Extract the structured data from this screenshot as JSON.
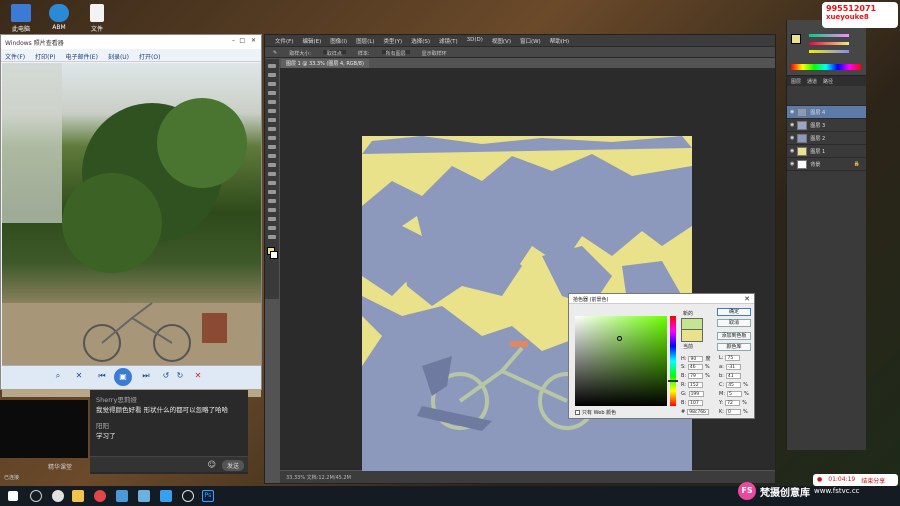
{
  "desktop": {
    "icons": [
      {
        "label": "此电脑",
        "icon": "computer-icon",
        "color": "#3b7bd6"
      },
      {
        "label": "ABM",
        "icon": "app-icon",
        "color": "#2a8ad6"
      },
      {
        "label": "文件",
        "icon": "file-icon",
        "color": "#f3f3f3"
      }
    ]
  },
  "viewer": {
    "title": "Windows 照片查看器",
    "menu": [
      "文件(F)",
      "打印(P)",
      "电子邮件(E)",
      "刻录(U)",
      "打开(O)"
    ],
    "controls": [
      "zoom-icon",
      "fit-icon",
      "prev-icon",
      "slideshow-icon",
      "next-icon",
      "rotate-left-icon",
      "rotate-right-icon",
      "delete-icon"
    ]
  },
  "chat": {
    "messages": [
      {
        "user": "Sherry思莉娅",
        "text": "我觉得颜色好看 形状什么的都可以忽略了哈哈"
      },
      {
        "user": "阳阳",
        "text": "学习了"
      }
    ],
    "send_label": "发送",
    "panel_label": "精华课堂",
    "status": "已连接"
  },
  "ps": {
    "menu": [
      "文件(F)",
      "编辑(E)",
      "图像(I)",
      "图层(L)",
      "类型(Y)",
      "选择(S)",
      "滤镜(T)",
      "3D(D)",
      "视图(V)",
      "窗口(W)",
      "帮助(H)"
    ],
    "options": [
      "取样大小:",
      "取样点",
      "样本:",
      "所有图层",
      "显示取样环"
    ],
    "doc_tab": "图层 1 @ 33.3% (图层 4, RGB/8)",
    "status": "33.33%   文档:12.2M/45.2M"
  },
  "picker": {
    "title": "拾色器 (前景色)",
    "new_label": "新的",
    "current_label": "当前",
    "ok": "确定",
    "cancel": "取消",
    "add_swatch": "添加到色板",
    "libraries": "颜色库",
    "hsb": [
      {
        "k": "H:",
        "v": "90"
      },
      {
        "k": "S:",
        "v": "46"
      },
      {
        "k": "B:",
        "v": "79"
      }
    ],
    "rgb": [
      {
        "k": "R:",
        "v": "152"
      },
      {
        "k": "G:",
        "v": "199"
      },
      {
        "k": "B:",
        "v": "107"
      }
    ],
    "lab": [
      {
        "k": "L:",
        "v": "75"
      },
      {
        "k": "a:",
        "v": "-31"
      },
      {
        "k": "b:",
        "v": "41"
      }
    ],
    "cmyk": [
      {
        "k": "C:",
        "v": "45"
      },
      {
        "k": "M:",
        "v": "5"
      },
      {
        "k": "Y:",
        "v": "72"
      },
      {
        "k": "K:",
        "v": "0"
      }
    ],
    "hex": "98c76b",
    "web_only": "只有 Web 颜色",
    "new_color": "#c5e48f",
    "current_color": "#e9e28a"
  },
  "layers": {
    "tabs": [
      "图层",
      "通道",
      "路径"
    ],
    "items": [
      {
        "name": "图层 4",
        "selected": true,
        "thumb": "#8c98bc"
      },
      {
        "name": "图层 3",
        "selected": false,
        "thumb": "#9aa6c7"
      },
      {
        "name": "图层 2",
        "selected": false,
        "thumb": "#8c98bc"
      },
      {
        "name": "图层 1",
        "selected": false,
        "thumb": "#e9e28a"
      },
      {
        "name": "背景",
        "selected": false,
        "thumb": "#ffffff"
      }
    ]
  },
  "overlay": {
    "qq_number": "995512071",
    "qq_user": "xueyouke8",
    "timer": "01:04:19",
    "stop_label": "结束分享"
  },
  "brand": {
    "logo": "FS",
    "name": "梵摄创意库",
    "url": "www.fstvc.cc"
  },
  "colors": {
    "canvas_yellow": "#e9e28a",
    "canvas_blue": "#8c98bc",
    "selection": "#5d7ba6"
  }
}
